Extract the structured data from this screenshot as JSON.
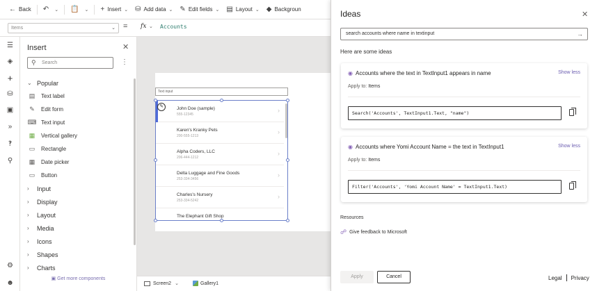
{
  "toolbar": {
    "back": "Back",
    "insert": "Insert",
    "add_data": "Add data",
    "edit_fields": "Edit fields",
    "layout": "Layout",
    "background": "Backgroun"
  },
  "formula_bar": {
    "property": "Items",
    "equals": "=",
    "fx": "fx",
    "formula": "Accounts"
  },
  "insert_panel": {
    "title": "Insert",
    "search_placeholder": "Search",
    "popular_label": "Popular",
    "popular_items": [
      {
        "label": "Text label",
        "icon": "text-label-icon"
      },
      {
        "label": "Edit form",
        "icon": "edit-form-icon"
      },
      {
        "label": "Text input",
        "icon": "text-input-icon"
      },
      {
        "label": "Vertical gallery",
        "icon": "vertical-gallery-icon"
      },
      {
        "label": "Rectangle",
        "icon": "rectangle-icon"
      },
      {
        "label": "Date picker",
        "icon": "date-picker-icon"
      },
      {
        "label": "Button",
        "icon": "button-icon"
      }
    ],
    "categories": [
      "Input",
      "Display",
      "Layout",
      "Media",
      "Icons",
      "Shapes",
      "Charts"
    ],
    "footer_link": "Get more components"
  },
  "canvas": {
    "text_input_placeholder": "Text input",
    "gallery_rows": [
      {
        "title": "John Doe (sample)",
        "sub": "555-12345"
      },
      {
        "title": "Karen's Kranky Pets",
        "sub": "200-555-1213"
      },
      {
        "title": "Alpha Coders, LLC",
        "sub": "206-444-1212"
      },
      {
        "title": "Delta Luggage and Fine Goods",
        "sub": "253-334-3456"
      },
      {
        "title": "Charles's Nursery",
        "sub": "253-334-5242"
      },
      {
        "title": "The Elephant Gift Shop",
        "sub": ""
      }
    ]
  },
  "status_bar": {
    "screen": "Screen2",
    "gallery": "Gallery1"
  },
  "ideas": {
    "title": "Ideas",
    "query": "search accounts where name in textinput",
    "subtitle": "Here are some ideas",
    "cards": [
      {
        "heading": "Accounts where the text in TextInput1 appears in name",
        "show_less": "Show less",
        "apply_label": "Apply to:",
        "apply_target": "Items",
        "code": "Search('Accounts', TextInput1.Text, \"name\")"
      },
      {
        "heading": "Accounts where Yomi Account Name = the text in TextInput1",
        "show_less": "Show less",
        "apply_label": "Apply to:",
        "apply_target": "Items",
        "code": "Filter('Accounts', 'Yomi Account Name' = TextInput1.Text)"
      }
    ],
    "resources_title": "Resources",
    "feedback_link": "Give feedback to Microsoft",
    "apply_button": "Apply",
    "cancel_button": "Cancel",
    "legal": "Legal",
    "privacy": "Privacy"
  },
  "colors": {
    "accent": "#6a5cb0",
    "selection": "#6a7fc9",
    "formula": "#2e7d6e"
  }
}
